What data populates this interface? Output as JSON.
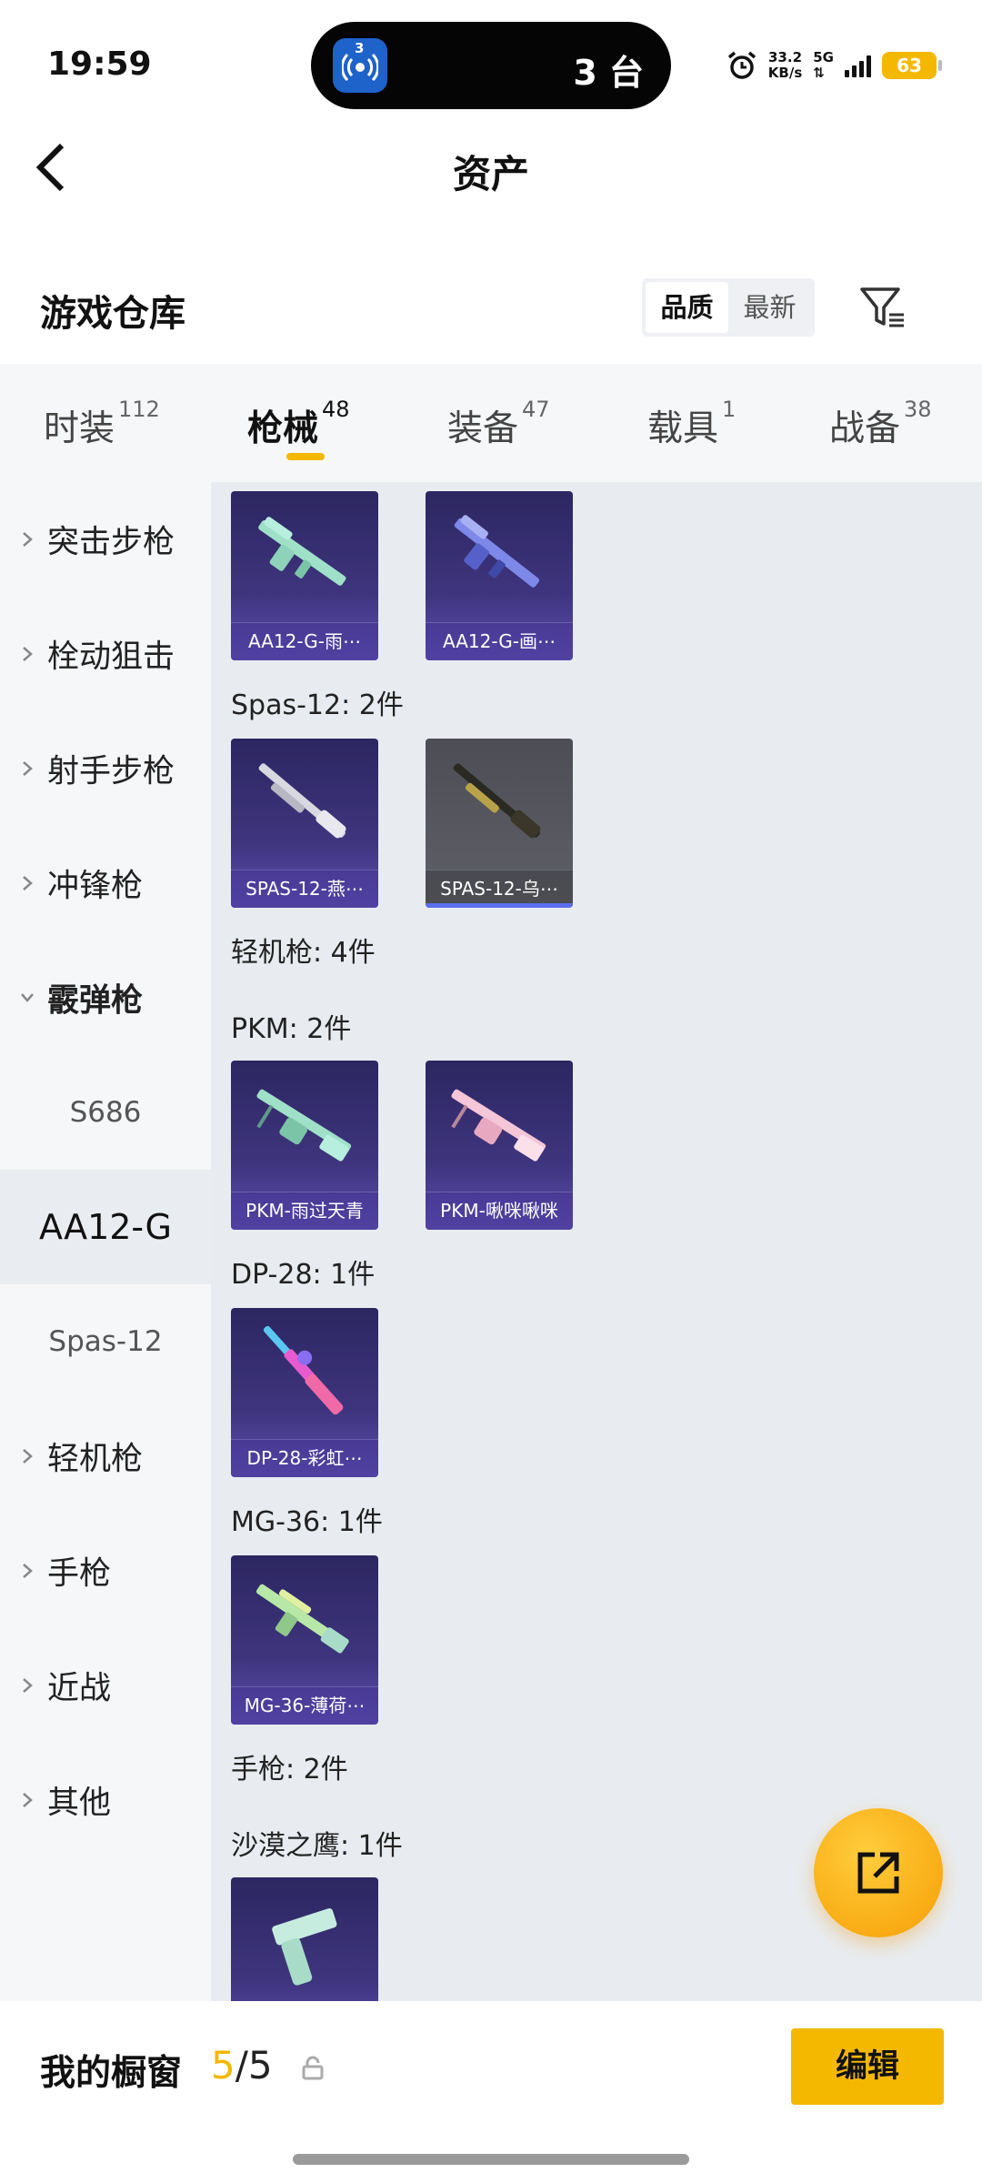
{
  "status_bar": {
    "time": "19:59",
    "island_badge": "3",
    "island_text": "3 台",
    "net_speed_value": "33.2",
    "net_speed_unit": "KB/s",
    "network": "5G",
    "battery": "63"
  },
  "header": {
    "title": "资产"
  },
  "warehouse": {
    "title": "游戏仓库",
    "sort_options": [
      "品质",
      "最新"
    ],
    "active_sort": "品质"
  },
  "tabs": [
    {
      "label": "时装",
      "count": "112"
    },
    {
      "label": "枪械",
      "count": "48"
    },
    {
      "label": "装备",
      "count": "47"
    },
    {
      "label": "载具",
      "count": "1"
    },
    {
      "label": "战备",
      "count": "38"
    }
  ],
  "active_tab": "枪械",
  "sidebar": {
    "items": [
      {
        "label": "突击步枪"
      },
      {
        "label": "栓动狙击"
      },
      {
        "label": "射手步枪"
      },
      {
        "label": "冲锋枪"
      },
      {
        "label": "霰弹枪"
      },
      {
        "label": "S686"
      },
      {
        "label": "AA12-G"
      },
      {
        "label": "Spas-12"
      },
      {
        "label": "轻机枪"
      },
      {
        "label": "手枪"
      },
      {
        "label": "近战"
      },
      {
        "label": "其他"
      }
    ],
    "active_item": "AA12-G"
  },
  "groups": [
    {
      "title": "Spas-12: 2件"
    },
    {
      "title": "轻机枪: 4件"
    },
    {
      "title": "PKM: 2件"
    },
    {
      "title": "DP-28: 1件"
    },
    {
      "title": "MG-36: 1件"
    },
    {
      "title": "手枪: 2件"
    },
    {
      "title": "沙漠之鹰: 1件"
    }
  ],
  "items": [
    {
      "label": "AA12-G-雨⋯",
      "icon": "shotgun-mint-icon",
      "color": "#9fe0c8"
    },
    {
      "label": "AA12-G-画⋯",
      "icon": "shotgun-blue-icon",
      "color": "#7d88e8"
    },
    {
      "label": "SPAS-12-燕⋯",
      "icon": "shotgun-white-icon",
      "color": "#d8d8e0"
    },
    {
      "label": "SPAS-12-乌⋯",
      "icon": "shotgun-gold-icon",
      "color": "#b9a24a"
    },
    {
      "label": "PKM-雨过天青",
      "icon": "machinegun-mint-icon",
      "color": "#9fe0c8"
    },
    {
      "label": "PKM-啾咪啾咪",
      "icon": "machinegun-pink-icon",
      "color": "#f4c6d8"
    },
    {
      "label": "DP-28-彩虹⋯",
      "icon": "rifle-rainbow-icon",
      "color": "#e85ad0"
    },
    {
      "label": "MG-36-薄荷⋯",
      "icon": "rifle-mint-icon",
      "color": "#b8e8a8"
    },
    {
      "label": "",
      "icon": "pistol-mint-icon",
      "color": "#c6ece0"
    }
  ],
  "bottom_bar": {
    "label": "我的橱窗",
    "count_current": "5",
    "count_separator": "/",
    "count_max": "5",
    "edit_label": "编辑"
  },
  "colors": {
    "accent": "#f5b800",
    "card_purple": "#3f357f"
  }
}
